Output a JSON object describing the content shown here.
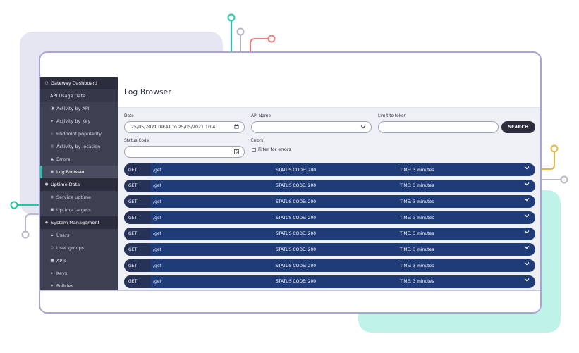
{
  "sidebar": {
    "sections": [
      {
        "label": "Gateway Dashboard",
        "icon": "gauge-icon",
        "sub_label": "API Usage Data",
        "items": [
          {
            "label": "Activity by API",
            "icon": "pie-chart-icon",
            "active": false
          },
          {
            "label": "Activity by Key",
            "icon": "key-icon",
            "active": false
          },
          {
            "label": "Endpoint popularity",
            "icon": "arrow-icon",
            "active": false
          },
          {
            "label": "Activity by location",
            "icon": "globe-icon",
            "active": false
          },
          {
            "label": "Errors",
            "icon": "warning-icon",
            "active": false
          },
          {
            "label": "Log Browser",
            "icon": "search-icon",
            "active": true
          }
        ]
      },
      {
        "label": "Uptime Data",
        "icon": "circle-icon",
        "items": [
          {
            "label": "Service uptime",
            "icon": "pulse-icon",
            "active": false
          },
          {
            "label": "Uptime targets",
            "icon": "target-icon",
            "active": false
          }
        ]
      },
      {
        "label": "System Management",
        "icon": "wrench-icon",
        "items": [
          {
            "label": "Users",
            "icon": "user-icon",
            "active": false
          },
          {
            "label": "User groups",
            "icon": "users-icon",
            "active": false
          },
          {
            "label": "APIs",
            "icon": "api-icon",
            "active": false
          },
          {
            "label": "Keys",
            "icon": "key-icon",
            "active": false
          },
          {
            "label": "Policies",
            "icon": "policy-icon",
            "active": false
          }
        ]
      }
    ]
  },
  "page": {
    "title": "Log Browser"
  },
  "filters": {
    "date_label": "Date",
    "date_value": "25/05/2021 09:41 to 25/05/2021 10:41",
    "api_name_label": "API Name",
    "api_name_value": "",
    "limit_token_label": "Limit to token",
    "limit_token_value": "",
    "search_label": "SEARCH",
    "status_code_label": "Status Code",
    "status_code_value": "",
    "errors_label": "Errors",
    "filter_errors_label": "Filter for errors",
    "filter_errors_checked": false
  },
  "logs": [
    {
      "method": "GET",
      "path": "/get",
      "status": "STATUS CODE: 200",
      "time": "TIME: 3 minutes"
    },
    {
      "method": "GET",
      "path": "/get",
      "status": "STATUS CODE: 200",
      "time": "TIME: 3 minutes"
    },
    {
      "method": "GET",
      "path": "/get",
      "status": "STATUS CODE: 200",
      "time": "TIME: 3 minutes"
    },
    {
      "method": "GET",
      "path": "/get",
      "status": "STATUS CODE: 200",
      "time": "TIME: 3 minutes"
    },
    {
      "method": "GET",
      "path": "/get",
      "status": "STATUS CODE: 200",
      "time": "TIME: 3 minutes"
    },
    {
      "method": "GET",
      "path": "/get",
      "status": "STATUS CODE: 200",
      "time": "TIME: 3 minutes"
    },
    {
      "method": "GET",
      "path": "/get",
      "status": "STATUS CODE: 200",
      "time": "TIME: 3 minutes"
    },
    {
      "method": "GET",
      "path": "/get",
      "status": "STATUS CODE: 200",
      "time": "TIME: 3 minutes"
    }
  ],
  "colors": {
    "sidebar_bg": "#2b2d3d",
    "accent": "#1fc8a8",
    "row_bg": "#1f3c79",
    "frame_border": "#a9a4d6",
    "decor_mint": "#bff3ea",
    "decor_lavender": "#e6e6f2",
    "decor_coral": "#f27c7c",
    "decor_yellow": "#e8b73a"
  }
}
